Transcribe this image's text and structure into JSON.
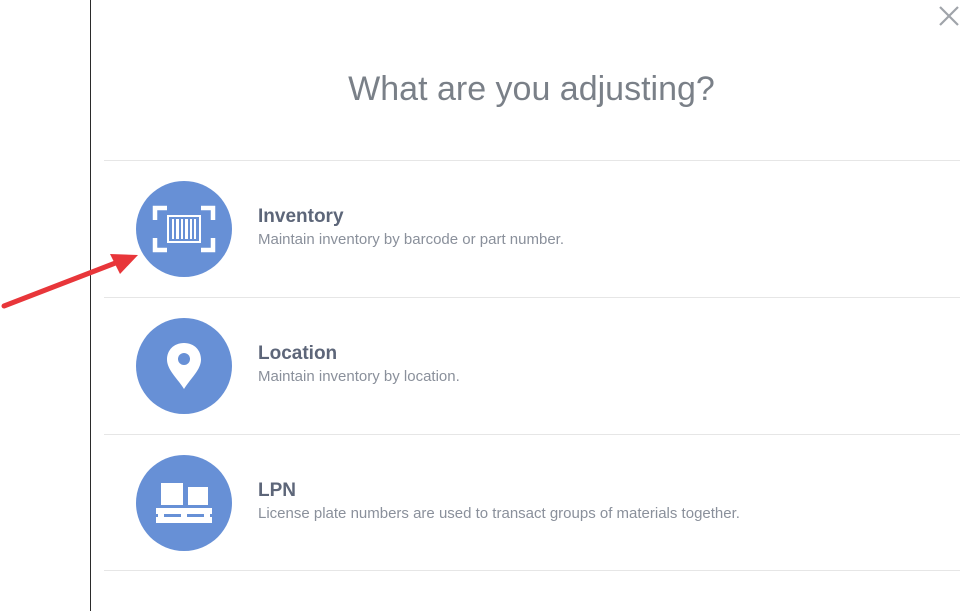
{
  "dialog": {
    "title": "What are you adjusting?",
    "close_icon": "close-icon"
  },
  "options": [
    {
      "title": "Inventory",
      "description": "Maintain inventory by barcode or part number.",
      "icon": "barcode-scan-icon"
    },
    {
      "title": "Location",
      "description": "Maintain inventory by location.",
      "icon": "map-pin-icon"
    },
    {
      "title": "LPN",
      "description": "License plate numbers are used to transact groups of materials together.",
      "icon": "pallet-boxes-icon"
    }
  ],
  "colors": {
    "icon_circle": "#6790d6",
    "title_text": "#7a8088",
    "option_title": "#5d6679",
    "option_desc": "#8a909b",
    "annotation_arrow": "#e8363a"
  }
}
